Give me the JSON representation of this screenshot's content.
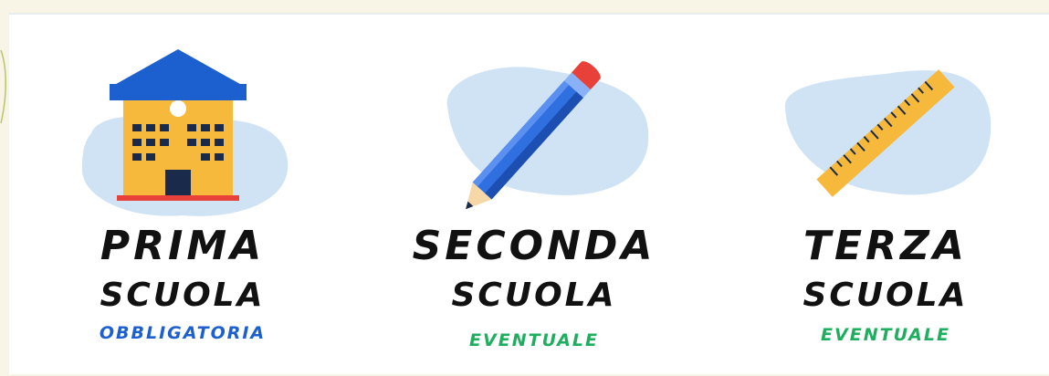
{
  "cards": [
    {
      "icon": "school-building-icon",
      "line1": "PRIMA",
      "line2": "SCUOLA",
      "line3": "OBBLIGATORIA",
      "line3_color": "#1c5fcf"
    },
    {
      "icon": "pencil-icon",
      "line1": "SECONDA",
      "line2": "SCUOLA",
      "line3": "EVENTUALE",
      "line3_color": "#1fae5f"
    },
    {
      "icon": "ruler-icon",
      "line1": "TERZA",
      "line2": "SCUOLA",
      "line3": "EVENTUALE",
      "line3_color": "#1fae5f"
    }
  ],
  "colors": {
    "blob": "#cfe3f5",
    "building_roof": "#1c5fcf",
    "building_wall": "#f6b93b",
    "pencil_body": "#2f6fe0",
    "ruler": "#f6b93b"
  }
}
